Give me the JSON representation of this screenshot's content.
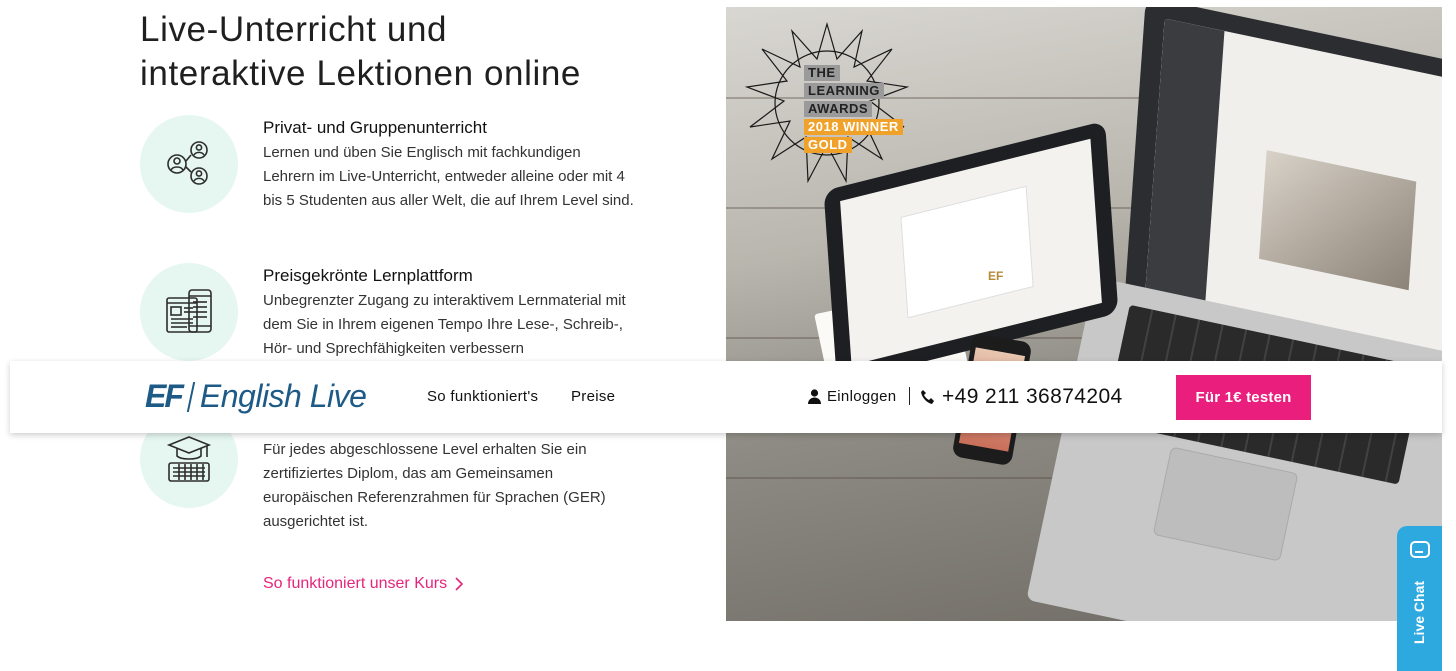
{
  "page": {
    "heading_line1": "Live-Unterricht und",
    "heading_line2": "interaktive Lektionen online"
  },
  "features": [
    {
      "title": "Privat- und Gruppenunterricht",
      "text": "Lernen und üben Sie Englisch mit fachkundigen Lehrern im Live-Unterricht, entweder alleine oder mit 4 bis 5 Studenten aus aller Welt, die auf Ihrem Level sind.",
      "icon": "group-users-icon"
    },
    {
      "title": "Preisgekrönte Lernplattform",
      "text": "Unbegrenzter Zugang zu interaktivem Lernmaterial mit dem Sie in Ihrem eigenen Tempo Ihre Lese-, Schreib-, Hör- und Sprechfähigkeiten verbessern",
      "icon": "devices-icon"
    },
    {
      "title": "",
      "text": "Für jedes abgeschlossene Level erhalten Sie ein zertifiziertes Diplom, das am Gemeinsamen europäischen Referenzrahmen für Sprachen (GER) ausgerichtet ist.",
      "icon": "graduation-cap-keyboard-icon"
    }
  ],
  "course_link": "So funktioniert unser Kurs",
  "award": {
    "line1": "THE",
    "line2": "LEARNING",
    "line3": "AWARDS",
    "line4": "2018 WINNER",
    "line5": "GOLD"
  },
  "hero": {
    "brand_mark": "EF"
  },
  "navbar": {
    "logo_ef": "EF",
    "logo_text": "English Live",
    "link_how": "So funktioniert's",
    "link_prices": "Preise",
    "login": "Einloggen",
    "phone": "+49 211 36874204",
    "cta": "Für 1€ testen"
  },
  "livechat": {
    "label": "Live Chat"
  },
  "colors": {
    "accent_pink": "#ea1f7d",
    "brand_blue": "#1d5b86",
    "icon_bg": "#e6f6f1",
    "chat_blue": "#2ea9e0",
    "award_gold": "#f0a12a"
  }
}
